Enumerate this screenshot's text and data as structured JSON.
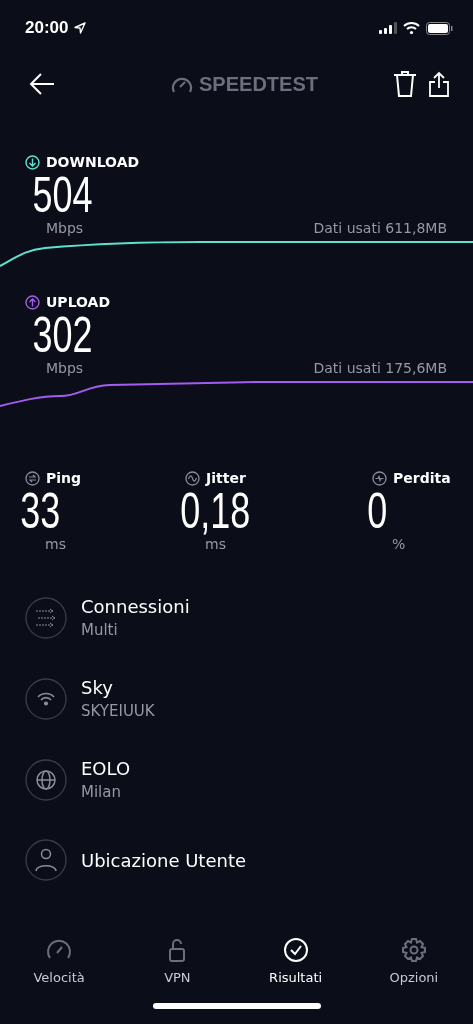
{
  "status_bar": {
    "time": "20:00"
  },
  "header": {
    "logo": "SPEEDTEST"
  },
  "speeds": [
    {
      "kind": "download",
      "label": "DOWNLOAD",
      "value": "504",
      "unit": "Mbps",
      "data_used": "Dati usati 611,8MB",
      "color": "#5fe0d0"
    },
    {
      "kind": "upload",
      "label": "UPLOAD",
      "value": "302",
      "unit": "Mbps",
      "data_used": "Dati usati 175,6MB",
      "color": "#a35cf0"
    }
  ],
  "metrics": [
    {
      "kind": "ping",
      "label": "Ping",
      "value": "33",
      "unit": "ms"
    },
    {
      "kind": "jitter",
      "label": "Jitter",
      "value": "0,18",
      "unit": "ms"
    },
    {
      "kind": "loss",
      "label": "Perdita",
      "value": "0",
      "unit": "%"
    }
  ],
  "details": [
    {
      "kind": "connections",
      "title": "Connessioni",
      "subtitle": "Multi"
    },
    {
      "kind": "wifi",
      "title": "Sky",
      "subtitle": "SKYEIUUK"
    },
    {
      "kind": "server",
      "title": "EOLO",
      "subtitle": "Milan"
    },
    {
      "kind": "user",
      "title": "Ubicazione Utente"
    }
  ],
  "tabs": [
    {
      "kind": "speed",
      "label": "Velocità",
      "selected": false
    },
    {
      "kind": "vpn",
      "label": "VPN",
      "selected": false
    },
    {
      "kind": "results",
      "label": "Risultati",
      "selected": true
    },
    {
      "kind": "settings",
      "label": "Opzioni",
      "selected": false
    }
  ]
}
